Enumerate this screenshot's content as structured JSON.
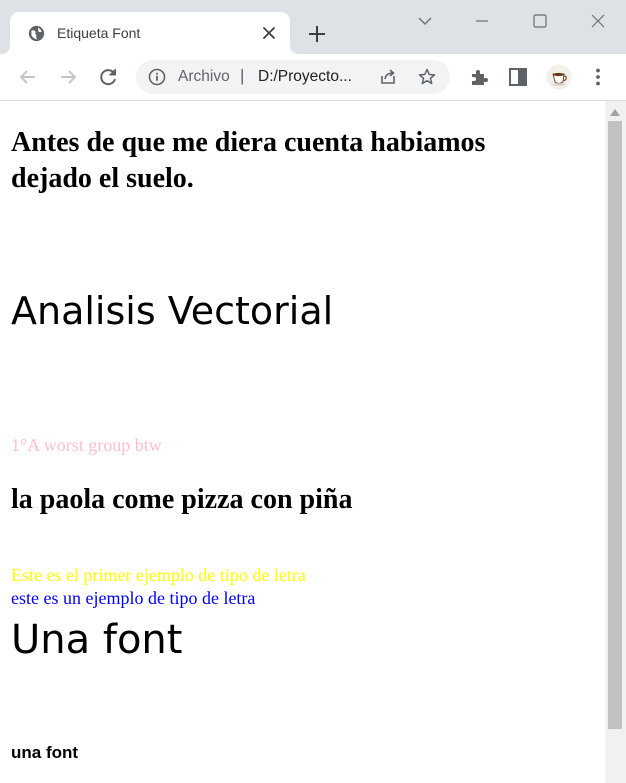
{
  "browser": {
    "tab": {
      "title": "Etiqueta Font",
      "favicon": "globe-icon"
    },
    "address_bar": {
      "scheme_label": "Archivo",
      "separator": "|",
      "url": "D:/Proyecto..."
    },
    "colors": {
      "tabstrip": "#dee1e6",
      "omnibox": "#f1f3f4",
      "icon": "#5f6368"
    }
  },
  "page": {
    "heading": "Antes de que me diera cuenta habiamos dejado el suelo.",
    "vector_title": "Analisis Vectorial",
    "group_text": "1°A worst group btw",
    "pizza_text": "la paola come pizza con piña",
    "yellow_text": "Este es el primer ejemplo de tipo de letra",
    "blue_text": "este es un ejemplo de tipo de letra",
    "una_font_large": "Una font",
    "una_font_small": "una font",
    "colors": {
      "pink": "#ffc0cb",
      "yellow": "#ffff00",
      "blue": "#0000ff",
      "black": "#000000"
    }
  }
}
